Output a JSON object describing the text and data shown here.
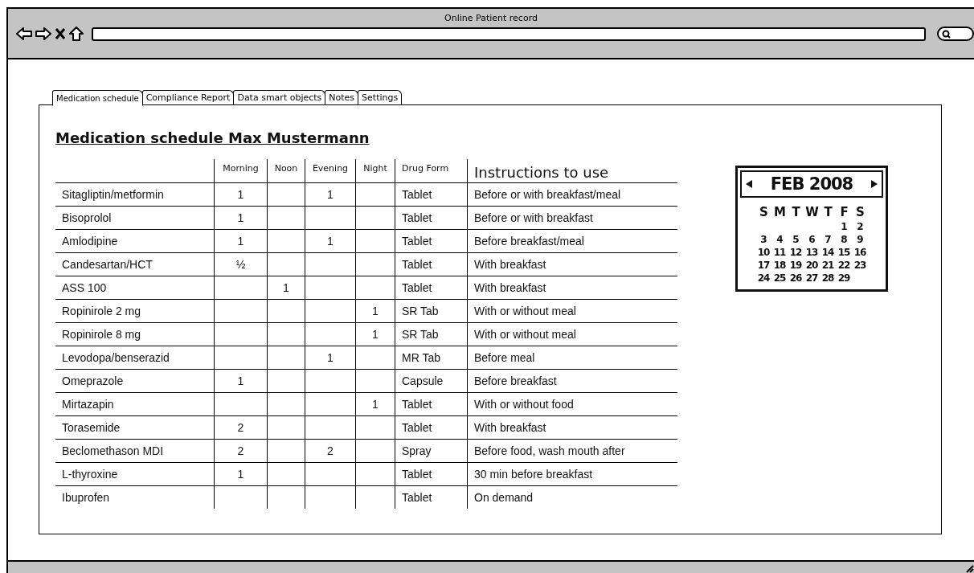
{
  "window": {
    "title": "Online Patient record"
  },
  "tabs": [
    {
      "label": "Medication schedule",
      "selected": true
    },
    {
      "label": "Compliance Report",
      "selected": false
    },
    {
      "label": "Data smart objects",
      "selected": false
    },
    {
      "label": "Notes",
      "selected": false
    },
    {
      "label": "Settings",
      "selected": false
    }
  ],
  "heading": "Medication schedule Max Mustermann",
  "table": {
    "columns": [
      "Morning",
      "Noon",
      "Evening",
      "Night",
      "Drug Form",
      "Instructions to use"
    ],
    "rows": [
      {
        "medication": "Sitagliptin/metformin",
        "morning": "1",
        "evening": "1",
        "drug_form": "Tablet",
        "instructions": "Before or with breakfast/meal"
      },
      {
        "medication": "Bisoprolol",
        "morning": "1",
        "drug_form": "Tablet",
        "instructions": "Before or with breakfast"
      },
      {
        "medication": "Amlodipine",
        "morning": "1",
        "evening": "1",
        "drug_form": "Tablet",
        "instructions": "Before breakfast/meal"
      },
      {
        "medication": "Candesartan/HCT",
        "morning": "½",
        "drug_form": "Tablet",
        "instructions": "With breakfast"
      },
      {
        "medication": "ASS 100",
        "noon": "1",
        "drug_form": "Tablet",
        "instructions": "With breakfast"
      },
      {
        "medication": "Ropinirole 2 mg",
        "night": "1",
        "drug_form": "SR Tab",
        "instructions": "With or without meal"
      },
      {
        "medication": "Ropinirole 8 mg",
        "night": "1",
        "drug_form": "SR Tab",
        "instructions": "With or without meal"
      },
      {
        "medication": "Levodopa/benserazid",
        "evening": "1",
        "drug_form": "MR Tab",
        "instructions": "Before meal"
      },
      {
        "medication": "Omeprazole",
        "morning": "1",
        "drug_form": "Capsule",
        "instructions": "Before breakfast"
      },
      {
        "medication": "Mirtazapin",
        "night": "1",
        "drug_form": "Tablet",
        "instructions": "With or without food"
      },
      {
        "medication": "Torasemide",
        "morning": "2",
        "drug_form": "Tablet",
        "instructions": "With breakfast"
      },
      {
        "medication": "Beclomethason MDI",
        "morning": "2",
        "evening": "2",
        "drug_form": "Spray",
        "instructions": "Before food, wash mouth after"
      },
      {
        "medication": "L-thyroxine",
        "morning": "1",
        "drug_form": "Tablet",
        "instructions": "30 min before breakfast"
      },
      {
        "medication": "Ibuprofen",
        "drug_form": "Tablet",
        "instructions": "On demand"
      }
    ]
  },
  "calendar": {
    "month": "FEB 2008",
    "weekdays": [
      "S",
      "M",
      "T",
      "W",
      "T",
      "F",
      "S"
    ],
    "weeks": [
      [
        "1",
        "2"
      ],
      [
        "3",
        "4",
        "5",
        "6",
        "7",
        "8",
        "9"
      ],
      [
        "10",
        "11",
        "12",
        "13",
        "14",
        "15",
        "16"
      ],
      [
        "17",
        "18",
        "19",
        "20",
        "21",
        "22",
        "23"
      ],
      [
        "24",
        "25",
        "26",
        "27",
        "28",
        "29"
      ]
    ]
  }
}
